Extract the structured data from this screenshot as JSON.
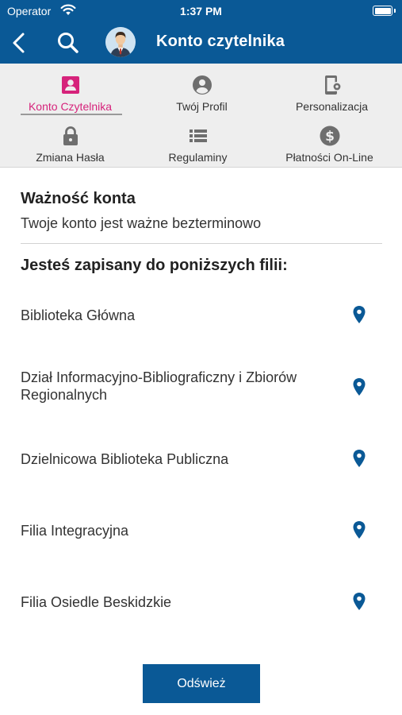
{
  "status_bar": {
    "carrier": "Operator",
    "time": "1:37 PM",
    "battery_level": 1.0
  },
  "nav": {
    "title": "Konto czytelnika",
    "back_icon": "chevron-left-icon",
    "search_icon": "search-icon",
    "avatar_icon": "user-avatar-icon"
  },
  "menu": {
    "items": [
      {
        "label": "Konto Czytelnika",
        "icon": "account-card-icon",
        "active": true
      },
      {
        "label": "Twój Profil",
        "icon": "user-circle-icon",
        "active": false
      },
      {
        "label": "Personalizacja",
        "icon": "phone-settings-icon",
        "active": false
      },
      {
        "label": "Zmiana Hasła",
        "icon": "lock-icon",
        "active": false
      },
      {
        "label": "Regulaminy",
        "icon": "list-icon",
        "active": false
      },
      {
        "label": "Płatności On-Line",
        "icon": "dollar-circle-icon",
        "active": false
      }
    ]
  },
  "validity": {
    "title": "Ważność konta",
    "text": "Twoje konto jest ważne bezterminowo"
  },
  "branches": {
    "title": "Jesteś zapisany do poniższych filii:",
    "items": [
      {
        "name": "Biblioteka Główna"
      },
      {
        "name": "Dział Informacyjno-Bibliograficzny i Zbiorów Regionalnych"
      },
      {
        "name": "Dzielnicowa Biblioteka Publiczna"
      },
      {
        "name": "Filia Integracyjna"
      },
      {
        "name": "Filia Osiedle Beskidzkie"
      }
    ]
  },
  "refresh_button": {
    "label": "Odśwież"
  },
  "colors": {
    "primary": "#0a5996",
    "active_tab": "#d6237b",
    "menu_background": "#eeeeee",
    "icon_gray": "#6e6e6e"
  }
}
